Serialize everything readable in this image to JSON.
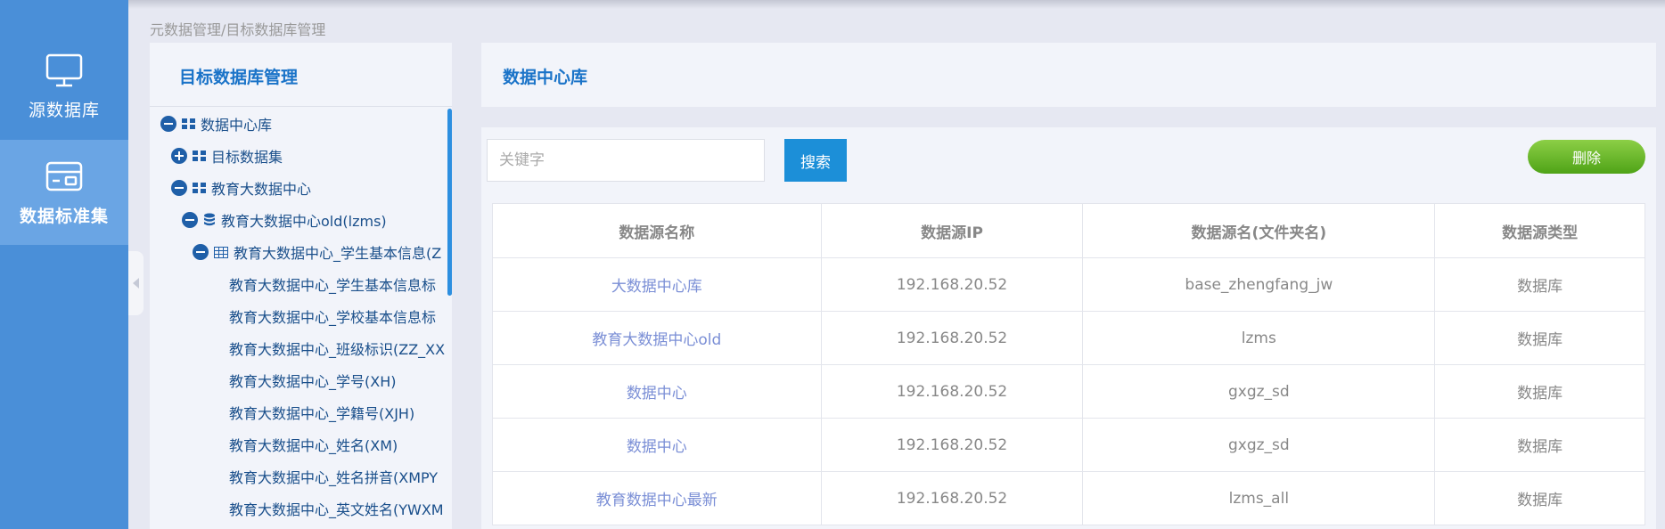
{
  "nav": {
    "items": [
      {
        "label": "源数据库",
        "icon": "monitor-icon"
      },
      {
        "label": "数据标准集",
        "icon": "card-icon"
      }
    ],
    "collapse_icon": "collapse-arrow-icon"
  },
  "breadcrumb": "元数据管理/目标数据库管理",
  "tree": {
    "title": "目标数据库管理",
    "nodes": [
      {
        "label": "数据中心库",
        "toggle": "minus",
        "icon": "grid-icon"
      },
      {
        "label": "目标数据集",
        "toggle": "plus",
        "icon": "grid-icon"
      },
      {
        "label": "教育大数据中心",
        "toggle": "minus",
        "icon": "grid-icon"
      },
      {
        "label": "教育大数据中心old(lzms)",
        "toggle": "minus",
        "icon": "database-icon"
      },
      {
        "label": "教育大数据中心_学生基本信息(Z",
        "toggle": "minus",
        "icon": "table-icon"
      },
      {
        "label": "教育大数据中心_学生基本信息标"
      },
      {
        "label": "教育大数据中心_学校基本信息标"
      },
      {
        "label": "教育大数据中心_班级标识(ZZ_XX"
      },
      {
        "label": "教育大数据中心_学号(XH)"
      },
      {
        "label": "教育大数据中心_学籍号(XJH)"
      },
      {
        "label": "教育大数据中心_姓名(XM)"
      },
      {
        "label": "教育大数据中心_姓名拼音(XMPY"
      },
      {
        "label": "教育大数据中心_英文姓名(YWXM"
      }
    ]
  },
  "header": {
    "title": "数据中心库"
  },
  "toolbar": {
    "search_placeholder": "关键字",
    "search_value": "",
    "search_label": "搜索",
    "delete_label": "删除"
  },
  "table": {
    "columns": [
      "数据源名称",
      "数据源IP",
      "数据源名(文件夹名)",
      "数据源类型"
    ],
    "rows": [
      [
        "大数据中心库",
        "192.168.20.52",
        "base_zhengfang_jw",
        "数据库"
      ],
      [
        "教育大数据中心old",
        "192.168.20.52",
        "lzms",
        "数据库"
      ],
      [
        "数据中心",
        "192.168.20.52",
        "gxgz_sd",
        "数据库"
      ],
      [
        "数据中心",
        "192.168.20.52",
        "gxgz_sd",
        "数据库"
      ],
      [
        "教育数据中心最新",
        "192.168.20.52",
        "lzms_all",
        "数据库"
      ]
    ]
  },
  "colors": {
    "nav_bg": "#4a8fd8",
    "nav_active_bg": "#6aa5e4",
    "title_blue": "#1a73c8",
    "tree_text": "#1a4f8b",
    "search_button": "#1c8fd8",
    "delete_button": "#6dbb2e",
    "link_text": "#7b8fd6"
  }
}
